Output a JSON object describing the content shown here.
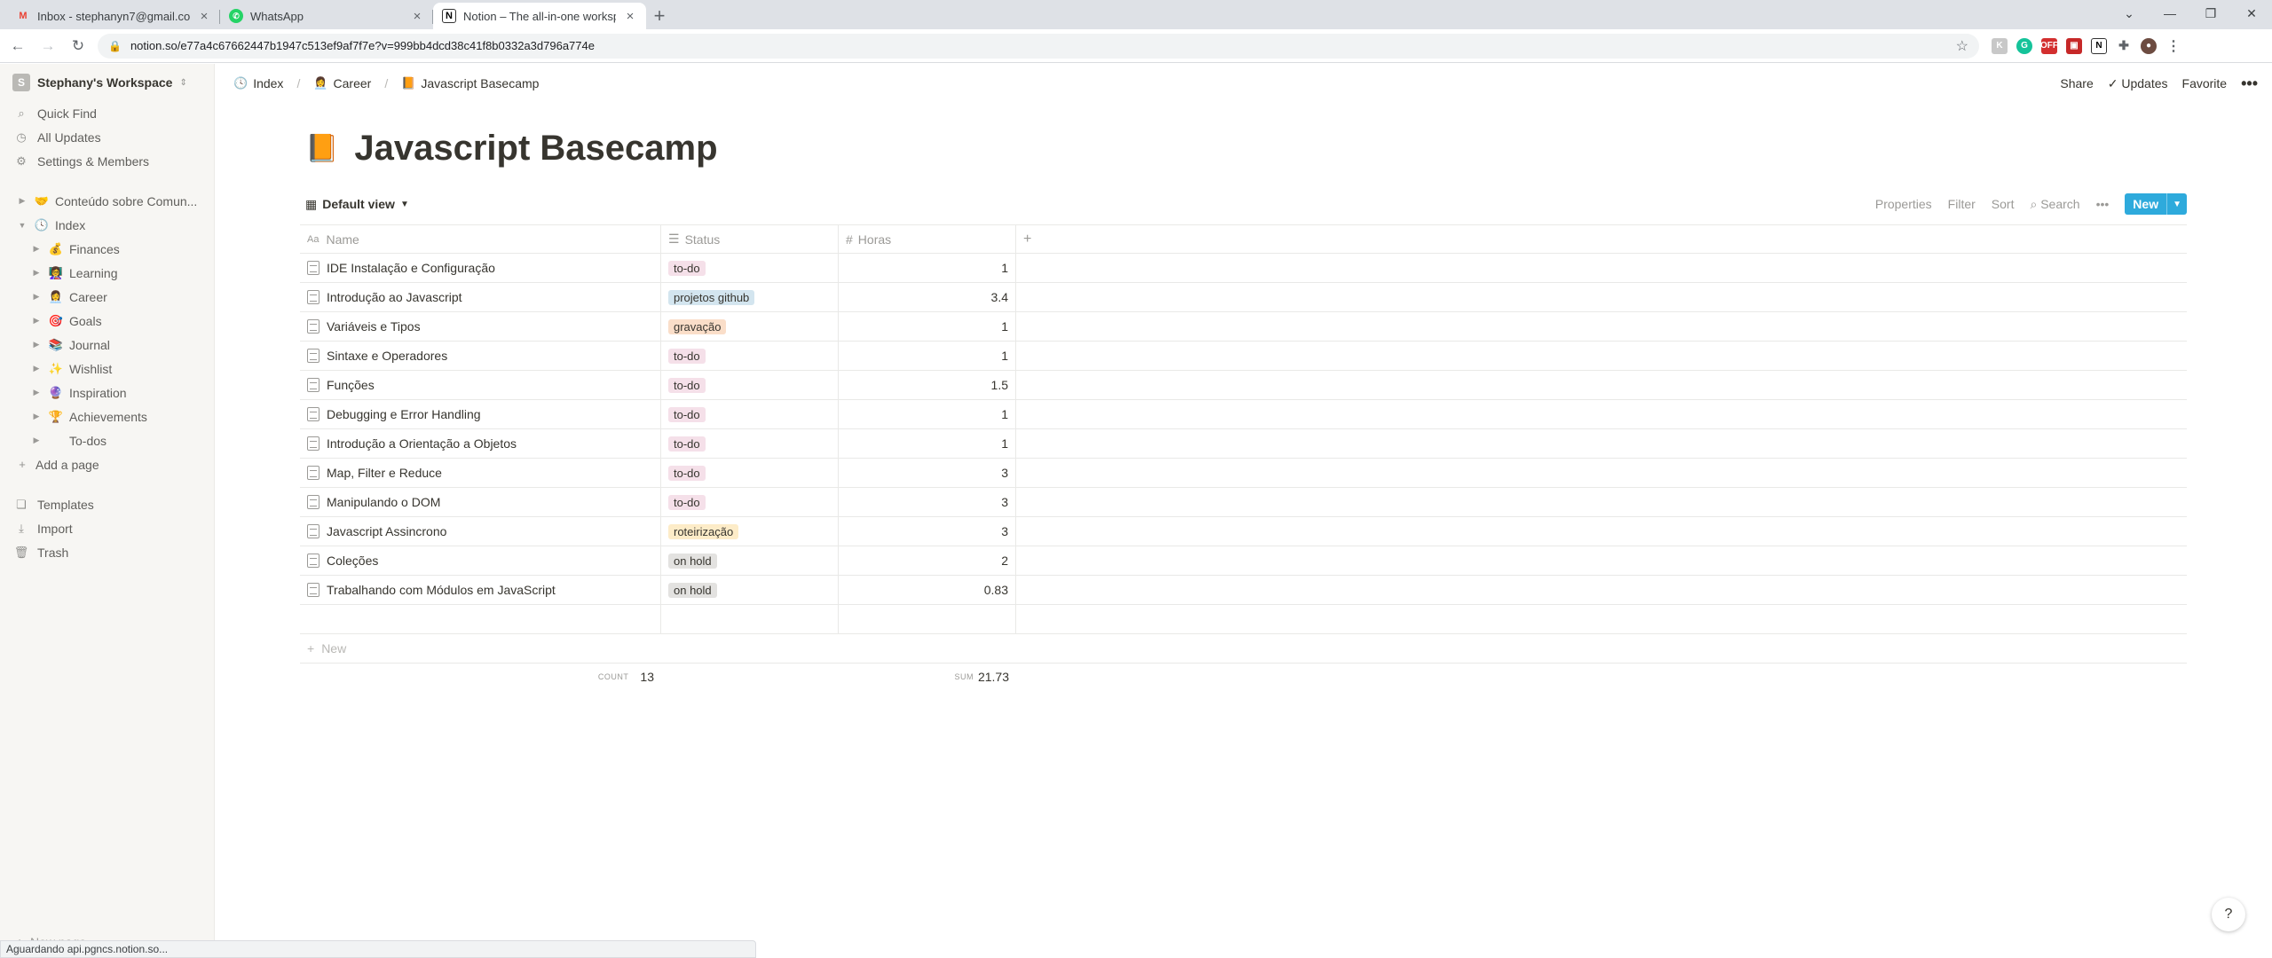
{
  "browser": {
    "tabs": [
      {
        "title": "Inbox - stephanyn7@gmail.com",
        "favicon": "gmail-icon",
        "active": false
      },
      {
        "title": "WhatsApp",
        "favicon": "whatsapp-icon",
        "active": false
      },
      {
        "title": "Notion – The all-in-one workspace",
        "favicon": "notion-icon",
        "active": true
      }
    ],
    "url": "notion.so/e77a4c67662447b1947c513ef9af7f7e?v=999bb4dcd38c41f8b0332a3d796a774e",
    "status_text": "Aguardando api.pgncs.notion.so..."
  },
  "sidebar": {
    "workspace": "Stephany's Workspace",
    "workspace_initial": "S",
    "actions": [
      {
        "label": "Quick Find",
        "icon": "search-icon"
      },
      {
        "label": "All Updates",
        "icon": "clock-icon"
      },
      {
        "label": "Settings & Members",
        "icon": "gear-icon"
      }
    ],
    "pages": [
      {
        "label": "Conteúdo sobre Comun...",
        "emoji": "🤝",
        "level": 0,
        "expanded": false
      },
      {
        "label": "Index",
        "emoji": "🕓",
        "level": 0,
        "expanded": true
      },
      {
        "label": "Finances",
        "emoji": "💰",
        "level": 1,
        "expanded": false
      },
      {
        "label": "Learning",
        "emoji": "👩‍🏫",
        "level": 1,
        "expanded": false
      },
      {
        "label": "Career",
        "emoji": "👩‍💼",
        "level": 1,
        "expanded": false
      },
      {
        "label": "Goals",
        "emoji": "🎯",
        "level": 1,
        "expanded": false
      },
      {
        "label": "Journal",
        "emoji": "📚",
        "level": 1,
        "expanded": false
      },
      {
        "label": "Wishlist",
        "emoji": "✨",
        "level": 1,
        "expanded": false
      },
      {
        "label": "Inspiration",
        "emoji": "🔮",
        "level": 1,
        "expanded": false
      },
      {
        "label": "Achievements",
        "emoji": "🏆",
        "level": 1,
        "expanded": false
      },
      {
        "label": "To-dos",
        "emoji": "",
        "level": 1,
        "expanded": false
      }
    ],
    "add_page": "Add a page",
    "bottom": [
      {
        "label": "Templates",
        "icon": "templates-icon"
      },
      {
        "label": "Import",
        "icon": "import-icon"
      },
      {
        "label": "Trash",
        "icon": "trash-icon"
      }
    ],
    "new_page": "New page"
  },
  "topbar": {
    "breadcrumbs": [
      {
        "label": "Index",
        "emoji": "🕓"
      },
      {
        "label": "Career",
        "emoji": "👩‍💼"
      },
      {
        "label": "Javascript Basecamp",
        "emoji": "📙"
      }
    ],
    "share": "Share",
    "updates": "Updates",
    "favorite": "Favorite"
  },
  "page": {
    "title": "Javascript Basecamp",
    "icon": "📙",
    "view": "Default view",
    "view_actions": {
      "properties": "Properties",
      "filter": "Filter",
      "sort": "Sort",
      "search": "Search",
      "new": "New"
    }
  },
  "table": {
    "columns": [
      {
        "label": "Name",
        "icon": "Aa"
      },
      {
        "label": "Status",
        "icon": "☰"
      },
      {
        "label": "Horas",
        "icon": "#"
      }
    ],
    "rows": [
      {
        "name": "IDE Instalação e Configuração",
        "status": "to-do",
        "horas": "1"
      },
      {
        "name": "Introdução ao Javascript",
        "status": "projetos github",
        "horas": "3.4"
      },
      {
        "name": "Variáveis e Tipos",
        "status": "gravação",
        "horas": "1"
      },
      {
        "name": "Sintaxe e Operadores",
        "status": "to-do",
        "horas": "1"
      },
      {
        "name": "Funções",
        "status": "to-do",
        "horas": "1.5"
      },
      {
        "name": "Debugging e Error Handling",
        "status": "to-do",
        "horas": "1"
      },
      {
        "name": "Introdução a Orientação a Objetos",
        "status": "to-do",
        "horas": "1"
      },
      {
        "name": "Map, Filter e Reduce",
        "status": "to-do",
        "horas": "3"
      },
      {
        "name": "Manipulando o DOM",
        "status": "to-do",
        "horas": "3"
      },
      {
        "name": "Javascript Assincrono",
        "status": "roteirização",
        "horas": "3"
      },
      {
        "name": "Coleções",
        "status": "on hold",
        "horas": "2"
      },
      {
        "name": "Trabalhando com Módulos em JavaScript",
        "status": "on hold",
        "horas": "0.83"
      }
    ],
    "status_colors": {
      "to-do": "#f5e0e9",
      "projetos github": "#d3e5ef",
      "gravação": "#fadec9",
      "roteirização": "#fdecc8",
      "on hold": "#e3e2e0"
    },
    "new_label": "New",
    "count_label": "COUNT",
    "count_value": "13",
    "sum_label": "SUM",
    "sum_value": "21.73"
  },
  "help": "?"
}
